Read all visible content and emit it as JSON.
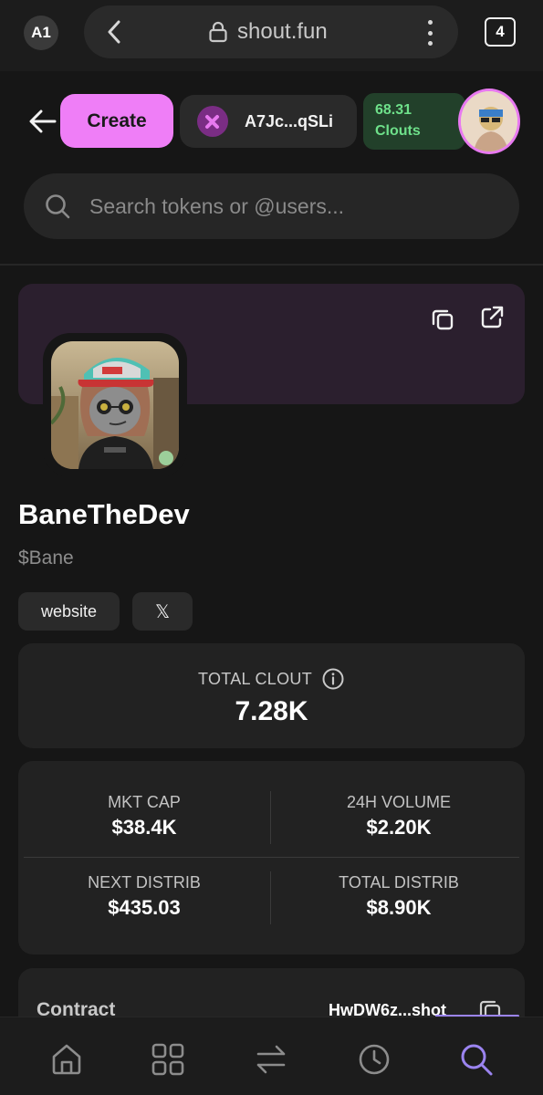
{
  "browser": {
    "profile": "A1",
    "url": "shout.fun",
    "tab_count": "4"
  },
  "header": {
    "create_label": "Create",
    "wallet_address": "A7Jc...qSLi",
    "clouts_value": "68.31",
    "clouts_label": "Clouts"
  },
  "search": {
    "placeholder": "Search tokens or @users..."
  },
  "token": {
    "name": "BaneTheDev",
    "ticker": "$Bane",
    "links": {
      "website": "website",
      "x": "𝕏"
    }
  },
  "total_clout": {
    "label": "TOTAL CLOUT",
    "value": "7.28K"
  },
  "stats": {
    "mkt_cap_label": "MKT CAP",
    "mkt_cap_value": "$38.4K",
    "volume_label": "24H VOLUME",
    "volume_value": "$2.20K",
    "next_distrib_label": "NEXT DISTRIB",
    "next_distrib_value": "$435.03",
    "total_distrib_label": "TOTAL DISTRIB",
    "total_distrib_value": "$8.90K"
  },
  "contract": {
    "label": "Contract",
    "address": "HwDW6z...shot"
  },
  "bottom_nav": [
    "home-icon",
    "grid-icon",
    "swap-icon",
    "history-icon",
    "search-icon"
  ],
  "colors": {
    "accent": "#ef7ef7",
    "clouts_green": "#6ee08a",
    "nav_active": "#9b84f0",
    "background": "#161616"
  }
}
